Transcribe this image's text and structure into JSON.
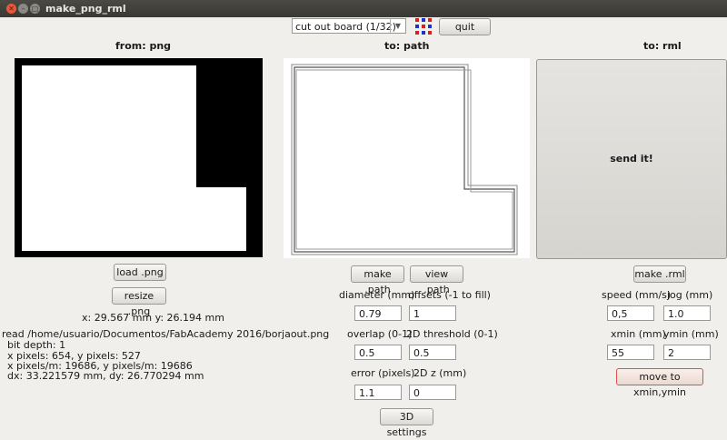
{
  "window": {
    "title": "make_png_rml"
  },
  "toolbar": {
    "process_select": "cut out board (1/32)",
    "quit_label": "quit",
    "grid_icon": "grid-icon"
  },
  "png_panel": {
    "header": "from: png",
    "load_label": "load .png",
    "resize_label": "resize .png",
    "coords": "x: 29.567 mm  y: 26.194 mm",
    "info": [
      "read /home/usuario/Documentos/FabAcademy 2016/borjaout.png",
      "bit depth: 1",
      "x pixels: 654, y pixels: 527",
      "x pixels/m: 19686, y pixels/m: 19686",
      "dx: 33.221579 mm, dy: 26.770294 mm"
    ]
  },
  "path_panel": {
    "header": "to: path",
    "make_label": "make .path",
    "view_label": "view .path",
    "diameter_label": "diameter (mm)",
    "diameter_value": "0.79",
    "offsets_label": "offsets (-1 to fill)",
    "offsets_value": "1",
    "overlap_label": "overlap (0-1)",
    "overlap_value": "0.5",
    "threshold_label": "2D threshold (0-1)",
    "threshold_value": "0.5",
    "error_label": "error (pixels)",
    "error_value": "1.1",
    "z_label": "2D z (mm)",
    "z_value": "0",
    "settings_label": "3D settings"
  },
  "rml_panel": {
    "header": "to: rml",
    "send_label": "send it!",
    "make_label": "make .rml",
    "speed_label": "speed (mm/s)",
    "speed_value": "0,5",
    "jog_label": "jog (mm)",
    "jog_value": "1.0",
    "xmin_label": "xmin (mm)",
    "xmin_value": "55",
    "ymin_label": "ymin (mm)",
    "ymin_value": "2",
    "move_label": "move to xmin,ymin"
  }
}
